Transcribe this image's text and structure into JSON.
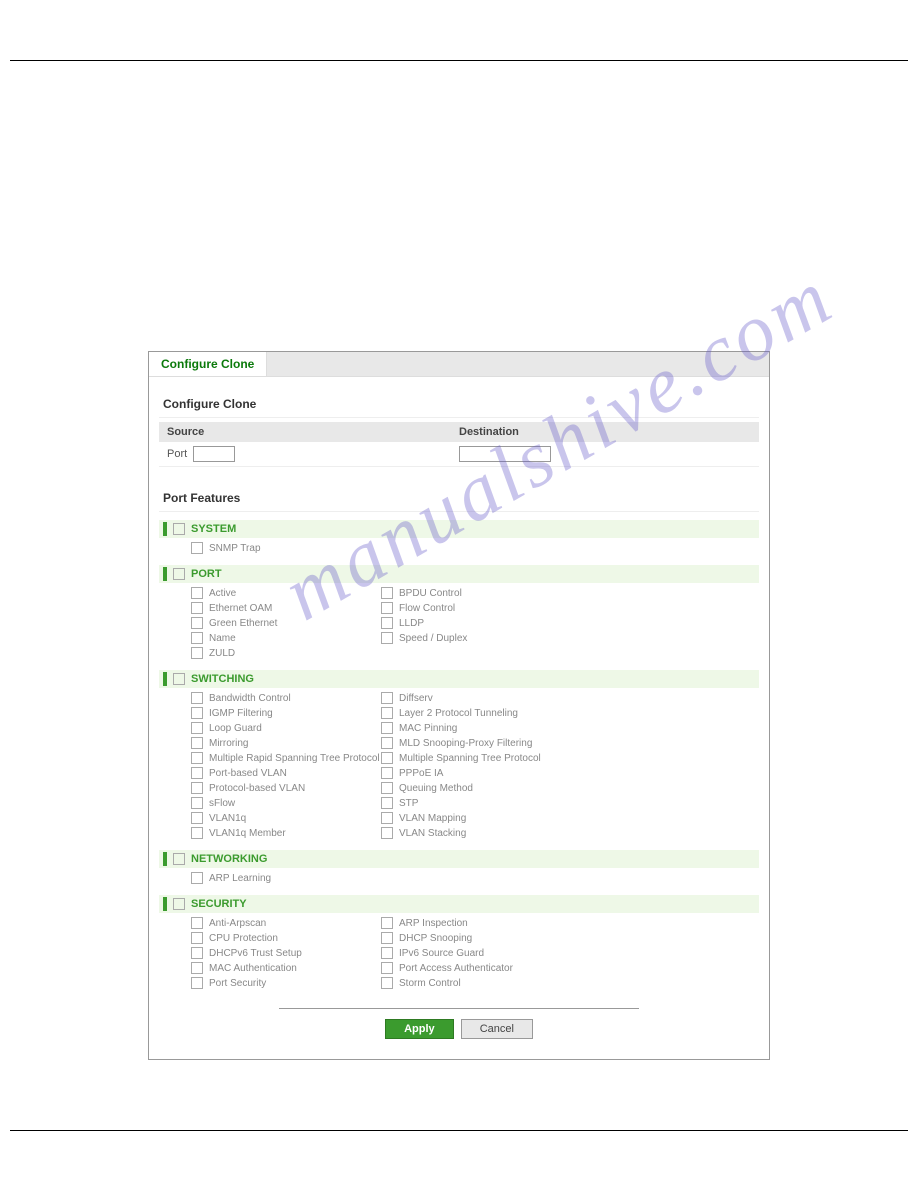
{
  "panel": {
    "tab": "Configure Clone",
    "sectionTitle": "Configure Clone",
    "sourceHead": "Source",
    "destHead": "Destination",
    "portLabel": "Port",
    "portFeaturesTitle": "Port Features"
  },
  "categories": [
    {
      "name": "SYSTEM",
      "items": [
        [
          "SNMP Trap"
        ]
      ]
    },
    {
      "name": "PORT",
      "items": [
        [
          "Active",
          "BPDU Control",
          "Ethernet OAM"
        ],
        [
          "Flow Control",
          "Green Ethernet",
          "LLDP"
        ],
        [
          "Name",
          "Speed / Duplex",
          "ZULD"
        ]
      ]
    },
    {
      "name": "SWITCHING",
      "items": [
        [
          "Bandwidth Control",
          "Diffserv",
          "IGMP Filtering"
        ],
        [
          "Layer 2 Protocol Tunneling",
          "Loop Guard",
          "MAC Pinning"
        ],
        [
          "Mirroring",
          "MLD Snooping-Proxy Filtering",
          "Multiple Rapid Spanning Tree Protocol"
        ],
        [
          "Multiple Spanning Tree Protocol",
          "Port-based VLAN",
          "PPPoE IA"
        ],
        [
          "Protocol-based VLAN",
          "Queuing Method",
          "sFlow"
        ],
        [
          "STP",
          "VLAN1q",
          "VLAN Mapping"
        ],
        [
          "VLAN1q Member",
          "VLAN Stacking"
        ]
      ]
    },
    {
      "name": "NETWORKING",
      "items": [
        [
          "ARP Learning"
        ]
      ]
    },
    {
      "name": "SECURITY",
      "items": [
        [
          "Anti-Arpscan",
          "ARP Inspection",
          "CPU Protection"
        ],
        [
          "DHCP Snooping",
          "DHCPv6 Trust Setup",
          "IPv6 Source Guard"
        ],
        [
          "MAC Authentication",
          "Port Access Authenticator",
          "Port Security"
        ],
        [
          "Storm Control"
        ]
      ]
    }
  ],
  "buttons": {
    "apply": "Apply",
    "cancel": "Cancel"
  },
  "watermark": "manualshive.com"
}
